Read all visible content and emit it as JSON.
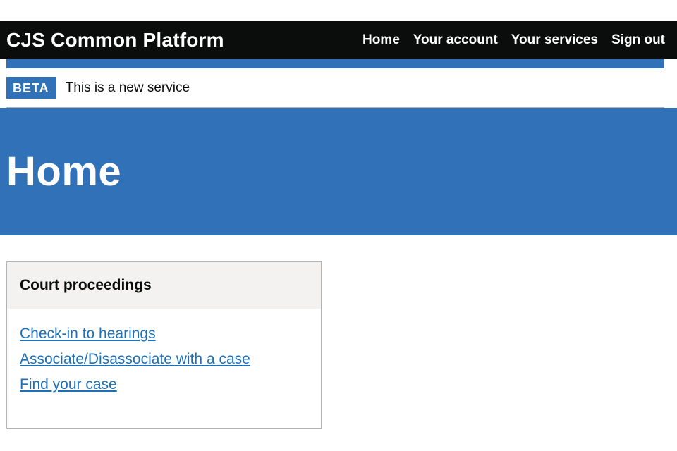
{
  "header": {
    "service_name": "CJS Common Platform",
    "nav": [
      "Home",
      "Your account",
      "Your services",
      "Sign out"
    ]
  },
  "phase_banner": {
    "tag": "BETA",
    "text": "This is a new service"
  },
  "hero": {
    "title": "Home"
  },
  "card": {
    "title": "Court proceedings",
    "links": [
      "Check-in to hearings",
      "Associate/Disassociate with a case",
      "Find your case"
    ]
  },
  "colors": {
    "header_bg": "#0b0c0c",
    "brand_blue": "#3071b7",
    "link": "#1d70b8",
    "card_header_bg": "#f3f2f1"
  }
}
